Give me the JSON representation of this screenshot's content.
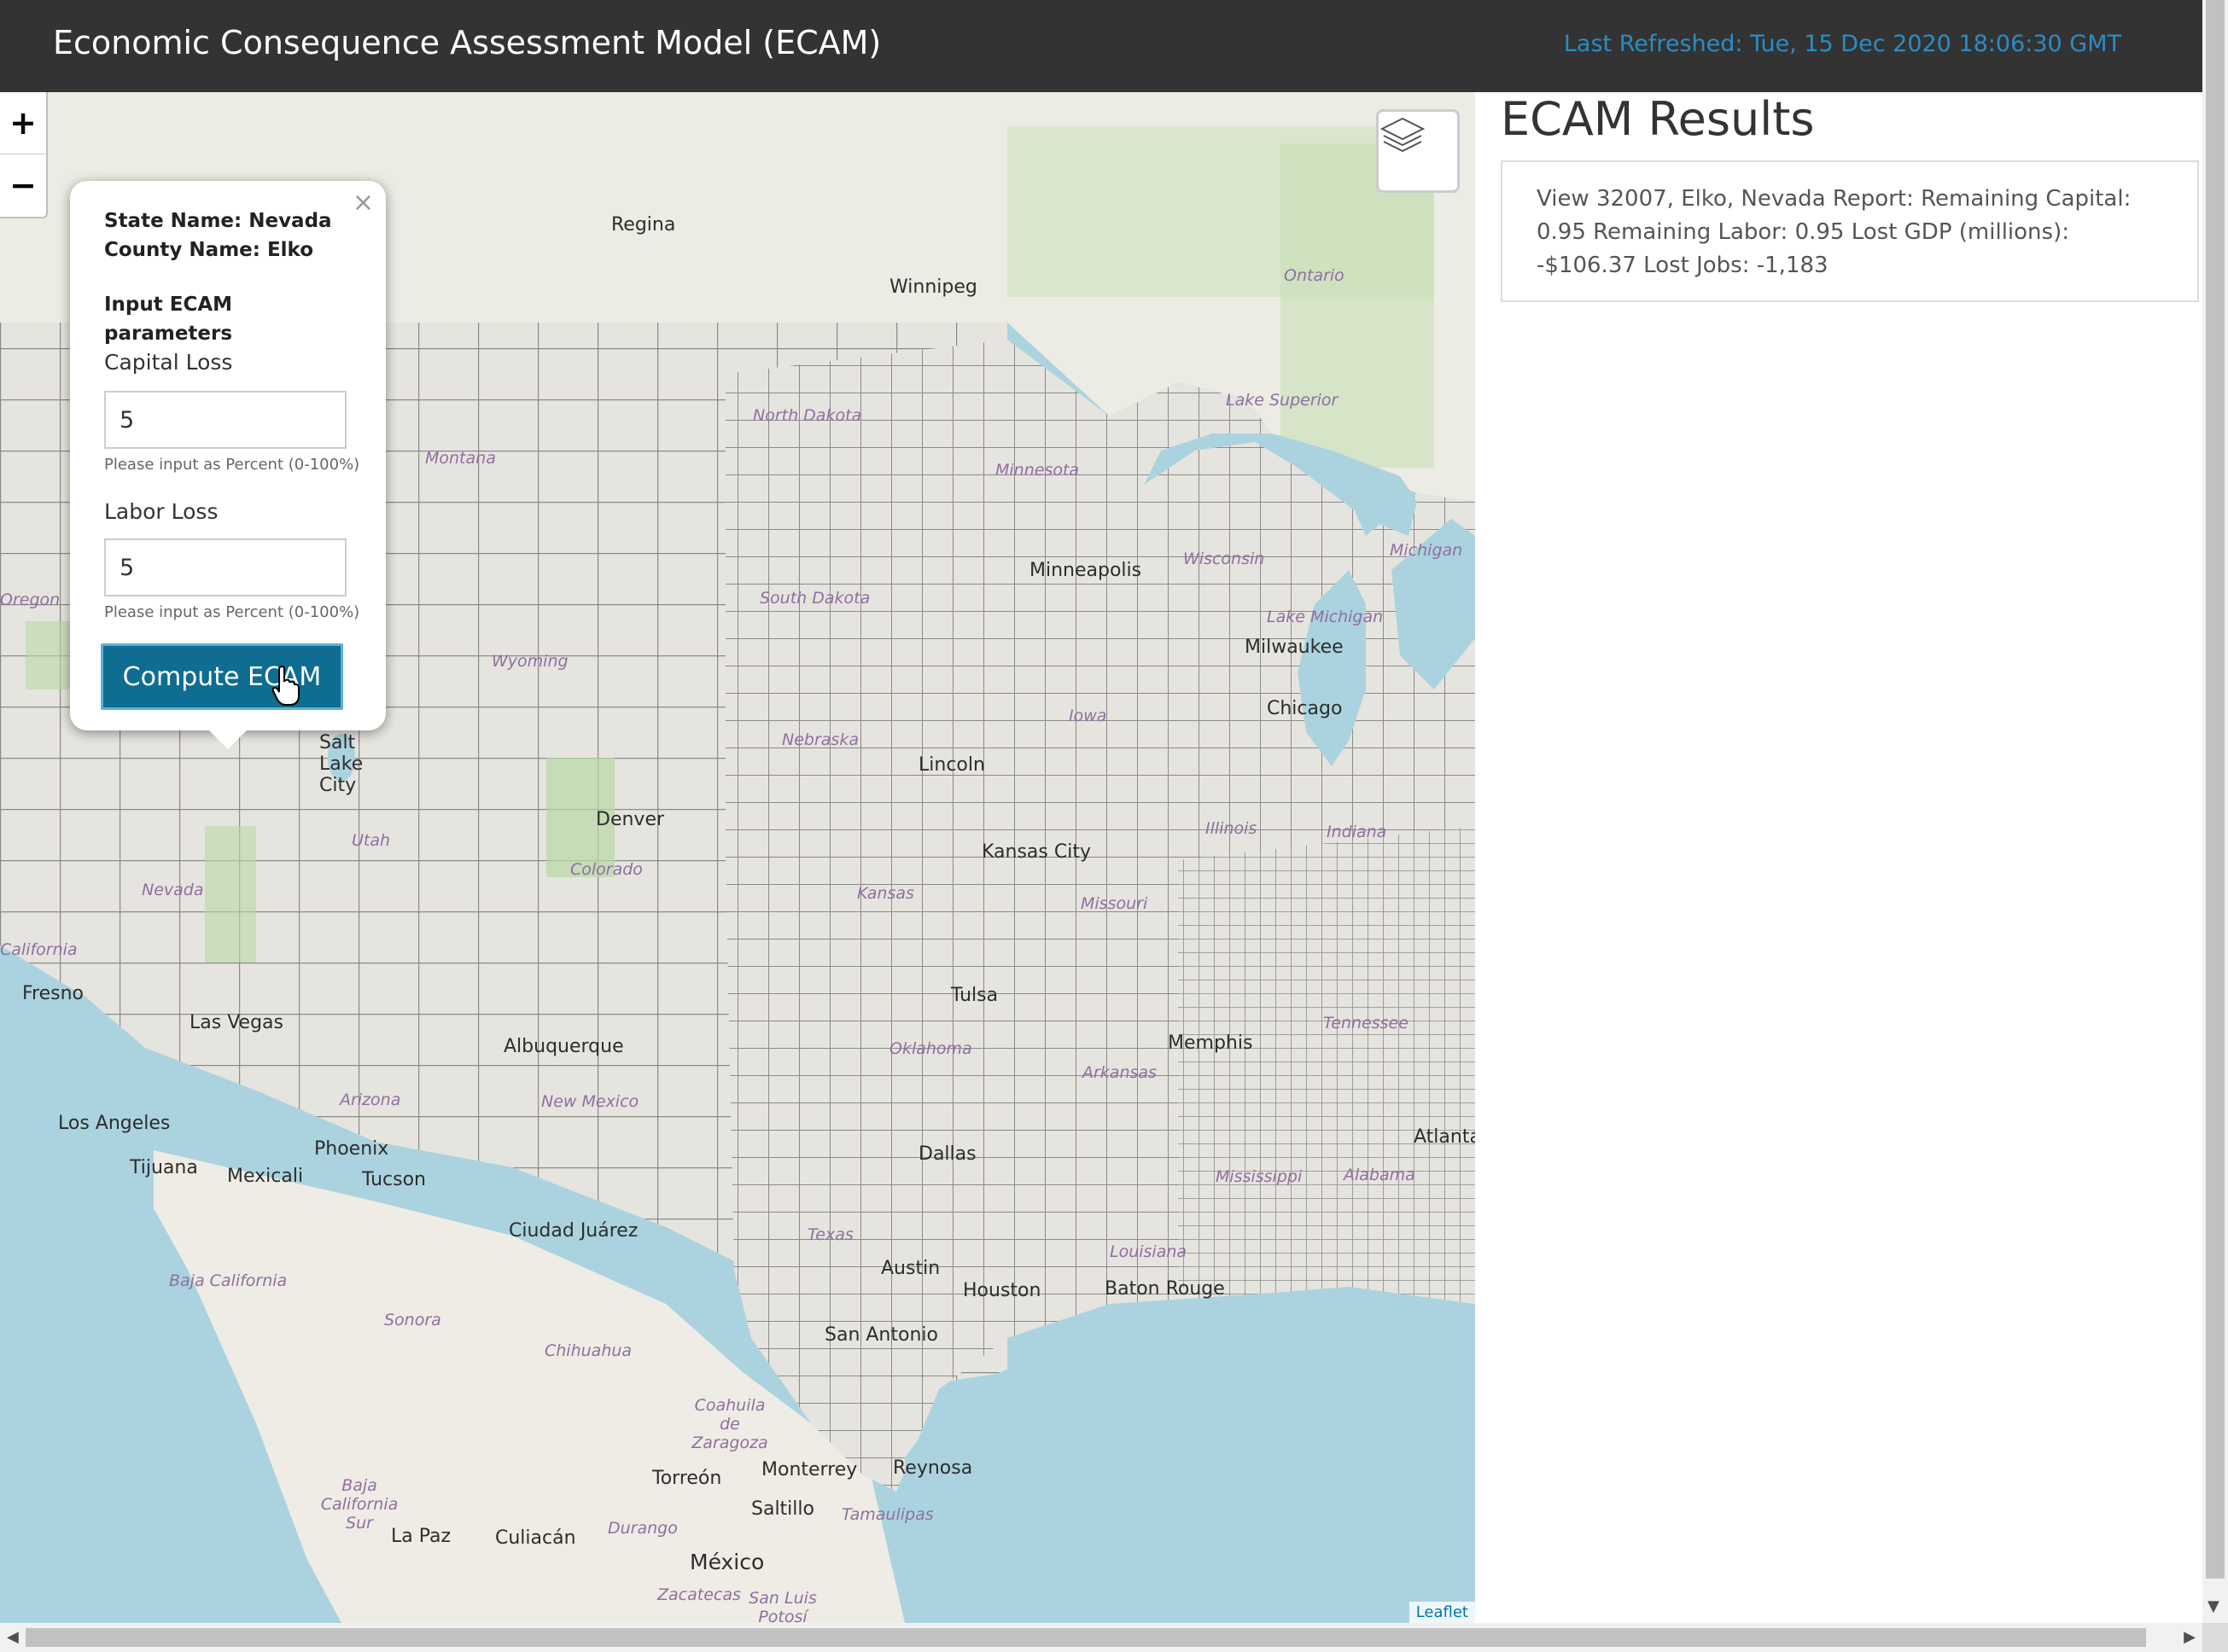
{
  "header": {
    "title": "Economic Consequence Assessment Model (ECAM)",
    "last_refreshed": "Last Refreshed: Tue, 15 Dec 2020 18:06:30 GMT"
  },
  "map": {
    "zoom_in": "+",
    "zoom_out": "−",
    "attribution": "Leaflet",
    "layers_icon": "layers-icon",
    "cities": [
      "Regina",
      "Winnipeg",
      "Minneapolis",
      "Milwaukee",
      "Chicago",
      "Salt Lake City",
      "Denver",
      "Lincoln",
      "Kansas City",
      "Fresno",
      "Las Vegas",
      "Albuquerque",
      "Tulsa",
      "Memphis",
      "Los Angeles",
      "Phoenix",
      "Tijuana",
      "Mexicali",
      "Tucson",
      "Dallas",
      "Atlanta",
      "Ciudad Juárez",
      "Austin",
      "Houston",
      "Baton Rouge",
      "San Antonio",
      "Torreón",
      "Monterrey",
      "Reynosa",
      "Saltillo",
      "La Paz",
      "Culiacán",
      "México"
    ],
    "regions": [
      "Ontario",
      "Lake Superior",
      "North Dakota",
      "Montana",
      "Minnesota",
      "South Dakota",
      "Wisconsin",
      "Michigan",
      "Lake Michigan",
      "Wyoming",
      "Nebraska",
      "Iowa",
      "Utah",
      "Colorado",
      "Nevada",
      "Kansas",
      "Missouri",
      "Illinois",
      "Indiana",
      "California",
      "Oklahoma",
      "Arkansas",
      "Tennessee",
      "Arizona",
      "New Mexico",
      "Mississippi",
      "Alabama",
      "Texas",
      "Louisiana",
      "Baja California",
      "Sonora",
      "Chihuahua",
      "Coahuila de Zaragoza",
      "Baja California Sur",
      "Durango",
      "Tamaulipas",
      "Zacatecas",
      "San Luis Potosí",
      "Oregon"
    ],
    "colors": {
      "water": "#abd3df",
      "land": "#e8e6df",
      "county_border": "#8a8a8a",
      "forest": "#b7d8a6"
    }
  },
  "popup": {
    "state_name": "State Name: Nevada",
    "county_name": "County Name: Elko",
    "section_title": "Input ECAM parameters",
    "capital_loss_label": "Capital Loss",
    "capital_loss_value": "5",
    "capital_help": "Please input as Percent (0-100%)",
    "labor_loss_label": "Labor Loss",
    "labor_loss_value": "5",
    "labor_help": "Please input as Percent (0-100%)",
    "compute_button": "Compute ECAM",
    "close": "×"
  },
  "results": {
    "title": "ECAM Results",
    "report_text": "View 32007, Elko, Nevada Report: Remaining Capital: 0.95 Remaining Labor: 0.95 Lost GDP (millions): -$106.37 Lost Jobs: -1,183"
  },
  "scrollbar": {
    "up": "▲",
    "down": "▼",
    "left": "◀",
    "right": "▶"
  },
  "accent_colors": {
    "topbar": "#333333",
    "refreshed_text": "#2b8cc4",
    "button": "#0e6d91"
  }
}
